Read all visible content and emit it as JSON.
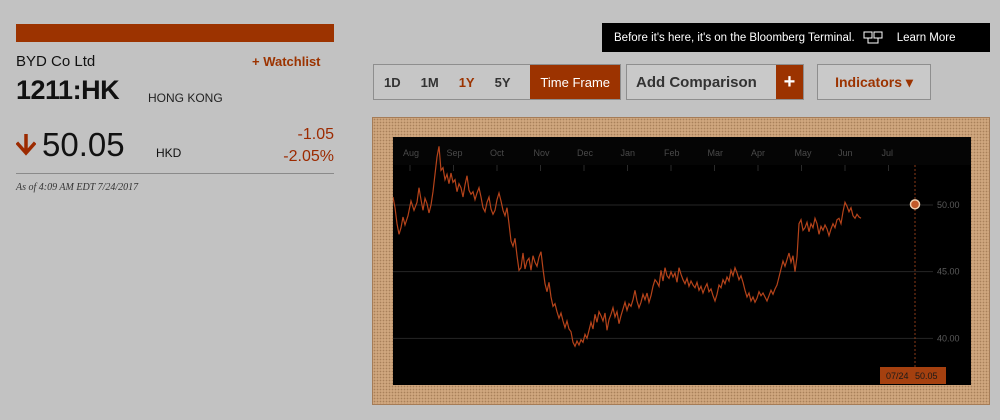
{
  "quote": {
    "company": "BYD Co Ltd",
    "watchlist_label": "+ Watchlist",
    "ticker": "1211:HK",
    "exchange": "HONG KONG",
    "price": "50.05",
    "currency": "HKD",
    "change": "-1.05",
    "change_pct": "-2.05%",
    "as_of": "As of 4:09 AM EDT 7/24/2017"
  },
  "promo": {
    "message": "Before it's here, it's on the Bloomberg Terminal.",
    "icon": "terminal-icon",
    "learn_more": "Learn More"
  },
  "controls": {
    "ranges": [
      "1D",
      "1M",
      "1Y",
      "5Y"
    ],
    "active_range": "1Y",
    "time_frame": "Time Frame",
    "add_comparison": "Add Comparison",
    "add_icon": "+",
    "indicators": "Indicators ▾"
  },
  "colors": {
    "accent": "#9c3300",
    "line": "#b5431a",
    "down": "#9c2a00",
    "chart_bg": "#000000"
  },
  "chart_data": {
    "type": "line",
    "months": [
      "Aug",
      "Sep",
      "Oct",
      "Nov",
      "Dec",
      "Jan",
      "Feb",
      "Mar",
      "Apr",
      "May",
      "Jun",
      "Jul"
    ],
    "y_ticks": [
      "50.00",
      "45.00",
      "40.00"
    ],
    "ylim": [
      36.5,
      53
    ],
    "x": [
      0,
      2,
      4,
      6,
      8,
      10,
      12,
      15,
      18,
      21,
      24,
      26,
      28,
      30,
      32,
      34,
      36,
      38,
      40,
      42,
      44,
      46,
      48,
      50,
      52,
      54,
      56,
      58,
      60,
      62,
      64,
      66,
      68,
      70,
      72,
      74,
      76,
      78,
      80,
      82,
      84,
      86,
      88,
      90,
      92,
      94,
      96,
      98,
      100,
      102,
      104,
      106,
      108,
      110,
      112,
      114,
      116,
      118,
      120,
      122,
      124,
      126,
      128,
      130,
      132,
      134,
      136,
      138,
      140,
      142,
      144,
      146,
      148,
      150,
      152,
      154,
      156,
      158,
      160,
      162,
      164,
      166,
      168,
      170,
      172,
      174,
      176,
      178,
      180,
      182,
      184,
      186,
      188,
      190,
      192,
      194,
      196,
      198,
      200,
      202,
      204,
      206,
      208,
      210,
      212,
      214,
      216,
      218,
      220,
      222,
      224,
      226,
      228,
      230,
      232,
      234,
      236,
      238,
      240,
      242,
      244,
      246,
      248,
      250,
      252,
      254,
      256,
      258,
      260,
      262,
      264,
      266,
      268,
      270,
      272,
      274,
      276,
      278,
      280,
      282,
      284,
      286,
      288,
      290,
      292,
      294,
      296,
      298,
      300,
      302,
      304,
      306,
      308,
      310,
      312,
      314,
      316,
      318,
      320,
      322,
      324,
      326,
      328,
      330,
      332,
      334,
      336,
      338,
      340,
      342,
      344,
      346,
      348,
      350,
      352,
      354,
      356,
      358,
      360,
      362,
      364,
      366,
      368,
      370,
      372,
      374,
      376,
      378,
      380,
      382,
      384,
      386,
      388,
      390,
      392,
      394,
      396,
      398,
      400,
      402,
      404,
      406,
      408,
      410,
      412,
      414,
      416,
      418,
      420,
      422,
      424,
      426,
      428,
      430,
      432,
      434,
      436,
      438,
      440,
      442,
      444,
      446,
      448,
      450,
      452,
      454,
      456,
      458,
      460,
      462,
      464,
      466,
      468,
      470,
      472,
      474,
      476,
      478,
      480,
      482,
      484,
      486,
      488,
      490,
      492,
      494,
      496,
      498,
      500,
      502,
      504,
      506,
      508,
      510,
      512,
      514,
      516,
      518,
      520,
      522
    ],
    "values": [
      50.6,
      49.8,
      48.6,
      47.8,
      48.3,
      49.1,
      48.5,
      49.2,
      50.3,
      49.6,
      50.2,
      51.3,
      50.4,
      49.6,
      50.5,
      50.1,
      49.4,
      50.0,
      51.0,
      52.3,
      53.6,
      54.4,
      52.6,
      52.8,
      51.9,
      52.3,
      51.6,
      52.4,
      51.7,
      51.9,
      51.0,
      51.6,
      51.3,
      50.6,
      51.5,
      52.2,
      51.1,
      50.8,
      51.0,
      50.4,
      50.9,
      51.3,
      50.6,
      49.8,
      49.5,
      50.2,
      50.6,
      49.7,
      49.3,
      49.6,
      50.4,
      50.9,
      50.3,
      49.6,
      49.2,
      49.8,
      48.6,
      47.3,
      46.9,
      47.5,
      46.2,
      45.1,
      45.3,
      46.4,
      45.2,
      45.8,
      46.0,
      45.1,
      46.2,
      45.7,
      45.4,
      46.1,
      46.5,
      45.2,
      44.1,
      43.5,
      44.2,
      43.1,
      42.4,
      42.6,
      42.0,
      41.5,
      41.9,
      41.3,
      40.8,
      41.3,
      40.7,
      40.5,
      39.7,
      39.4,
      39.8,
      39.5,
      39.9,
      39.7,
      40.3,
      40.0,
      40.6,
      41.2,
      40.7,
      41.8,
      41.2,
      42.0,
      41.7,
      41.3,
      41.9,
      40.6,
      41.4,
      41.8,
      42.3,
      41.6,
      42.0,
      41.1,
      41.7,
      42.2,
      42.7,
      42.1,
      42.6,
      42.4,
      42.9,
      43.6,
      42.8,
      42.3,
      42.7,
      43.3,
      42.9,
      43.4,
      42.7,
      43.2,
      43.9,
      44.4,
      44.2,
      43.9,
      45.1,
      44.3,
      45.3,
      44.7,
      44.5,
      45.0,
      44.6,
      44.9,
      44.2,
      45.3,
      44.8,
      44.4,
      44.1,
      44.5,
      43.9,
      44.3,
      44.0,
      43.8,
      44.2,
      43.6,
      43.9,
      43.4,
      43.8,
      44.1,
      43.5,
      43.7,
      43.2,
      42.8,
      43.3,
      44.0,
      43.8,
      44.4,
      44.1,
      44.6,
      44.3,
      45.1,
      44.7,
      45.3,
      44.9,
      44.4,
      44.7,
      44.2,
      43.6,
      43.1,
      43.4,
      42.8,
      43.1,
      42.7,
      43.0,
      43.5,
      43.2,
      43.4,
      43.1,
      42.8,
      43.2,
      43.6,
      43.3,
      43.7,
      44.0,
      44.6,
      45.2,
      45.8,
      45.4,
      45.9,
      46.4,
      45.7,
      46.2,
      45.0,
      46.1,
      48.6,
      48.9,
      48.1,
      48.3,
      48.7,
      48.0,
      48.6,
      48.3,
      49.0,
      48.6,
      47.8,
      48.4,
      48.1,
      48.5,
      48.2,
      47.7,
      48.2,
      48.6,
      48.3,
      48.9,
      49.0,
      48.6,
      49.5,
      50.2,
      49.9,
      49.5,
      49.8,
      49.2,
      49.0,
      49.3,
      49.1,
      49.0
    ],
    "last_value": 50.05,
    "tooltip_date": "07/24",
    "tooltip_value": "50.05",
    "grid": true
  }
}
